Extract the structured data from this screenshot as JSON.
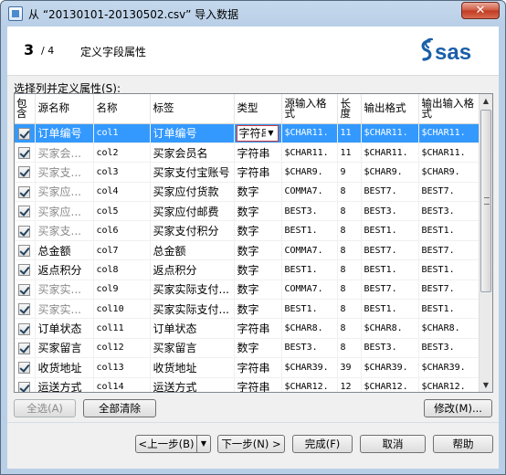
{
  "window": {
    "title": "从 “20130101-20130502.csv” 导入数据",
    "close_label": "✕"
  },
  "wizard": {
    "step_number": "3",
    "step_total": "/ 4",
    "step_title": "定义字段属性",
    "logo_text": "sas"
  },
  "section_label": "选择列并定义属性(S):",
  "columns": {
    "include": "包含",
    "source_name": "源名称",
    "name": "名称",
    "label": "标签",
    "type": "类型",
    "source_informat": "源输入格式",
    "length": "长度",
    "output_format": "输出格式",
    "output_informat": "输出输入格式"
  },
  "rows": [
    {
      "checked": true,
      "source_name": "订单编号",
      "name": "col1",
      "label": "订单编号",
      "type": "字符串",
      "source_informat": "$CHAR11.",
      "length": "11",
      "output_format": "$CHAR11.",
      "output_informat": "$CHAR11.",
      "selected": true,
      "dim": false
    },
    {
      "checked": true,
      "source_name": "买家会...",
      "name": "col2",
      "label": "买家会员名",
      "type": "字符串",
      "source_informat": "$CHAR11.",
      "length": "11",
      "output_format": "$CHAR11.",
      "output_informat": "$CHAR11.",
      "selected": false,
      "dim": true
    },
    {
      "checked": true,
      "source_name": "买家支...",
      "name": "col3",
      "label": "买家支付宝账号",
      "type": "字符串",
      "source_informat": "$CHAR9.",
      "length": "9",
      "output_format": "$CHAR9.",
      "output_informat": "$CHAR9.",
      "selected": false,
      "dim": true
    },
    {
      "checked": true,
      "source_name": "买家应...",
      "name": "col4",
      "label": "买家应付货款",
      "type": "数字",
      "source_informat": "COMMA7.",
      "length": "8",
      "output_format": "BEST7.",
      "output_informat": "BEST7.",
      "selected": false,
      "dim": true
    },
    {
      "checked": true,
      "source_name": "买家应...",
      "name": "col5",
      "label": "买家应付邮费",
      "type": "数字",
      "source_informat": "BEST3.",
      "length": "8",
      "output_format": "BEST3.",
      "output_informat": "BEST3.",
      "selected": false,
      "dim": true
    },
    {
      "checked": true,
      "source_name": "买家支...",
      "name": "col6",
      "label": "买家支付积分",
      "type": "数字",
      "source_informat": "BEST1.",
      "length": "8",
      "output_format": "BEST1.",
      "output_informat": "BEST1.",
      "selected": false,
      "dim": true
    },
    {
      "checked": true,
      "source_name": "总金额",
      "name": "col7",
      "label": "总金额",
      "type": "数字",
      "source_informat": "COMMA7.",
      "length": "8",
      "output_format": "BEST7.",
      "output_informat": "BEST7.",
      "selected": false,
      "dim": false
    },
    {
      "checked": true,
      "source_name": "返点积分",
      "name": "col8",
      "label": "返点积分",
      "type": "数字",
      "source_informat": "BEST1.",
      "length": "8",
      "output_format": "BEST1.",
      "output_informat": "BEST1.",
      "selected": false,
      "dim": false
    },
    {
      "checked": true,
      "source_name": "买家实...",
      "name": "col9",
      "label": "买家实际支付...",
      "type": "数字",
      "source_informat": "COMMA7.",
      "length": "8",
      "output_format": "BEST7.",
      "output_informat": "BEST7.",
      "selected": false,
      "dim": true
    },
    {
      "checked": true,
      "source_name": "买家实...",
      "name": "col10",
      "label": "买家实际支付...",
      "type": "数字",
      "source_informat": "BEST1.",
      "length": "8",
      "output_format": "BEST1.",
      "output_informat": "BEST1.",
      "selected": false,
      "dim": true
    },
    {
      "checked": true,
      "source_name": "订单状态",
      "name": "col11",
      "label": "订单状态",
      "type": "字符串",
      "source_informat": "$CHAR8.",
      "length": "8",
      "output_format": "$CHAR8.",
      "output_informat": "$CHAR8.",
      "selected": false,
      "dim": false
    },
    {
      "checked": true,
      "source_name": "买家留言",
      "name": "col12",
      "label": "买家留言",
      "type": "数字",
      "source_informat": "BEST3.",
      "length": "8",
      "output_format": "BEST3.",
      "output_informat": "BEST3.",
      "selected": false,
      "dim": false
    },
    {
      "checked": true,
      "source_name": "收货地址",
      "name": "col13",
      "label": "收货地址",
      "type": "字符串",
      "source_informat": "$CHAR39.",
      "length": "39",
      "output_format": "$CHAR39.",
      "output_informat": "$CHAR39.",
      "selected": false,
      "dim": false
    },
    {
      "checked": true,
      "source_name": "运送方式",
      "name": "col14",
      "label": "运送方式",
      "type": "字符串",
      "source_informat": "$CHAR12.",
      "length": "12",
      "output_format": "$CHAR12.",
      "output_informat": "$CHAR12.",
      "selected": false,
      "dim": false
    }
  ],
  "buttons": {
    "select_all": "全选(A)",
    "clear_all": "全部清除",
    "modify": "修改(M)...",
    "back": "<上一步(B)",
    "next": "下一步(N) >",
    "finish": "完成(F)",
    "cancel": "取消",
    "help": "帮助"
  },
  "colors": {
    "selection": "#3399ff",
    "window_frame": "#b9cfe7",
    "close_button": "#c03a20",
    "logo": "#1a5ea8"
  }
}
